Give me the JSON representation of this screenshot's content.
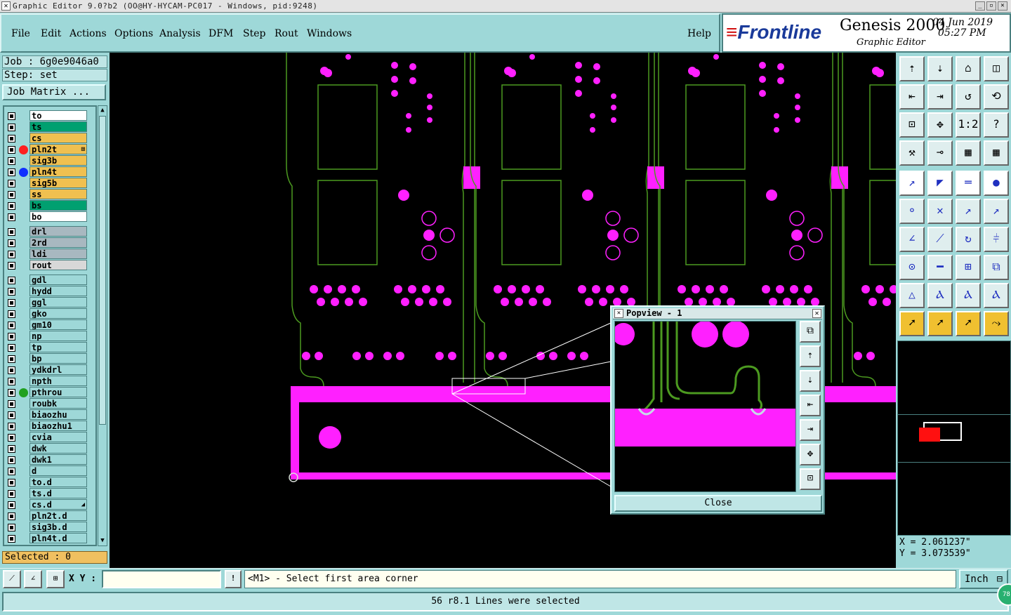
{
  "window": {
    "title": "Graphic Editor 9.0?b2 (OO@HY-HYCAM-PC017 - Windows, pid:9248)"
  },
  "menu": [
    "File",
    "Edit",
    "Actions",
    "Options",
    "Analysis",
    "DFM",
    "Step",
    "Rout",
    "Windows"
  ],
  "help_label": "Help",
  "brand": {
    "logo": "Frontline",
    "product": "Genesis 2000",
    "subtitle": "Graphic Editor",
    "date": "04 Jun 2019",
    "time": "05:27 PM"
  },
  "job": {
    "job": "Job : 6g0e9046a0",
    "step": "Step: set",
    "matrix_button": "Job Matrix ..."
  },
  "layers": [
    {
      "name": "to",
      "color": "#ffffff",
      "dot": ""
    },
    {
      "name": "ts",
      "color": "#00a070",
      "dot": ""
    },
    {
      "name": "cs",
      "color": "#f0c050",
      "dot": ""
    },
    {
      "name": "pln2t",
      "color": "#f0c050",
      "dot": "#ff2020",
      "mark": "⊞"
    },
    {
      "name": "sig3b",
      "color": "#f0c050",
      "dot": ""
    },
    {
      "name": "pln4t",
      "color": "#f0c050",
      "dot": "#1030ff"
    },
    {
      "name": "sig5b",
      "color": "#f0c050",
      "dot": ""
    },
    {
      "name": "ss",
      "color": "#f0c050",
      "dot": ""
    },
    {
      "name": "bs",
      "color": "#00a070",
      "dot": ""
    },
    {
      "name": "bo",
      "color": "#ffffff",
      "dot": ""
    },
    {
      "name": "drl",
      "color": "#a8b8c0",
      "dot": "",
      "gap": true
    },
    {
      "name": "2rd",
      "color": "#a8b8c0",
      "dot": ""
    },
    {
      "name": "ldi",
      "color": "#a8b8c0",
      "dot": ""
    },
    {
      "name": "rout",
      "color": "#d8d8d8",
      "dot": ""
    },
    {
      "name": "gdl",
      "color": "#9ed8d8",
      "dot": "",
      "gap": true
    },
    {
      "name": "hydd",
      "color": "#9ed8d8",
      "dot": ""
    },
    {
      "name": "ggl",
      "color": "#9ed8d8",
      "dot": ""
    },
    {
      "name": "gko",
      "color": "#9ed8d8",
      "dot": ""
    },
    {
      "name": "gm10",
      "color": "#9ed8d8",
      "dot": ""
    },
    {
      "name": "np",
      "color": "#9ed8d8",
      "dot": ""
    },
    {
      "name": "tp",
      "color": "#9ed8d8",
      "dot": ""
    },
    {
      "name": "bp",
      "color": "#9ed8d8",
      "dot": ""
    },
    {
      "name": "ydkdrl",
      "color": "#9ed8d8",
      "dot": ""
    },
    {
      "name": "npth",
      "color": "#9ed8d8",
      "dot": ""
    },
    {
      "name": "pthrou",
      "color": "#9ed8d8",
      "dot": "#20a020"
    },
    {
      "name": "roubk",
      "color": "#9ed8d8",
      "dot": ""
    },
    {
      "name": "biaozhu",
      "color": "#9ed8d8",
      "dot": ""
    },
    {
      "name": "biaozhu1",
      "color": "#9ed8d8",
      "dot": ""
    },
    {
      "name": "cvia",
      "color": "#9ed8d8",
      "dot": ""
    },
    {
      "name": "dwk",
      "color": "#9ed8d8",
      "dot": ""
    },
    {
      "name": "dwk1",
      "color": "#9ed8d8",
      "dot": ""
    },
    {
      "name": "d",
      "color": "#9ed8d8",
      "dot": ""
    },
    {
      "name": "to.d",
      "color": "#9ed8d8",
      "dot": ""
    },
    {
      "name": "ts.d",
      "color": "#9ed8d8",
      "dot": ""
    },
    {
      "name": "cs.d",
      "color": "#9ed8d8",
      "dot": "",
      "mark": "◢"
    },
    {
      "name": "pln2t.d",
      "color": "#9ed8d8",
      "dot": ""
    },
    {
      "name": "sig3b.d",
      "color": "#9ed8d8",
      "dot": ""
    },
    {
      "name": "pln4t.d",
      "color": "#9ed8d8",
      "dot": ""
    }
  ],
  "selected": "Selected : 0",
  "popview": {
    "title": "Popview - 1",
    "close_label": "Close"
  },
  "coords": {
    "x": "X = 2.061237\"",
    "y": "Y = 3.073539\""
  },
  "bottom": {
    "xy_label": "X Y :",
    "xy_value": "",
    "prompt": "<M1> - Select first area corner",
    "unit": "Inch"
  },
  "status": {
    "message": "56 r8.1 Lines were selected",
    "badge": "78"
  }
}
